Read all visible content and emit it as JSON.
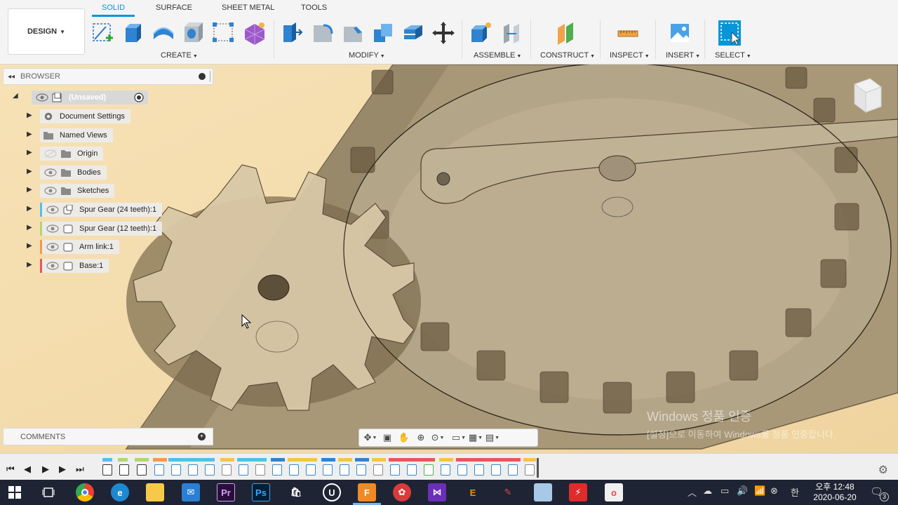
{
  "toolbar": {
    "workspace": "DESIGN",
    "tabs": [
      "SOLID",
      "SURFACE",
      "SHEET METAL",
      "TOOLS"
    ],
    "active_tab": "SOLID",
    "groups": {
      "create": "CREATE",
      "modify": "MODIFY",
      "assemble": "ASSEMBLE",
      "construct": "CONSTRUCT",
      "inspect": "INSPECT",
      "insert": "INSERT",
      "select": "SELECT"
    }
  },
  "browser": {
    "title": "BROWSER",
    "root": "(Unsaved)",
    "items": [
      {
        "label": "Document Settings",
        "icon": "gear-icon"
      },
      {
        "label": "Named Views",
        "icon": "folder-icon"
      },
      {
        "label": "Origin",
        "icon": "folder-icon"
      },
      {
        "label": "Bodies",
        "icon": "folder-icon"
      },
      {
        "label": "Sketches",
        "icon": "folder-icon"
      },
      {
        "label": "Spur Gear (24 teeth):1",
        "icon": "component-icon",
        "color": "#4fc1e9"
      },
      {
        "label": "Spur Gear (12 teeth):1",
        "icon": "component-icon",
        "color": "#b5d56a"
      },
      {
        "label": "Arm link:1",
        "icon": "component-icon",
        "color": "#f39a4a"
      },
      {
        "label": "Base:1",
        "icon": "component-icon",
        "color": "#e8575b"
      }
    ]
  },
  "comments": {
    "title": "COMMENTS"
  },
  "watermark": {
    "line1": "Windows 정품 인증",
    "line2": "[설정]으로 이동하여 Windows를 정품 인증합니다."
  },
  "taskbar": {
    "tray_lang": "한",
    "time": "오후 12:48",
    "date": "2020-06-20",
    "notifications": "3"
  },
  "colors": {
    "accent": "#0696d7",
    "viewport": "#f0d9a8",
    "taskbar": "#1e2433"
  }
}
